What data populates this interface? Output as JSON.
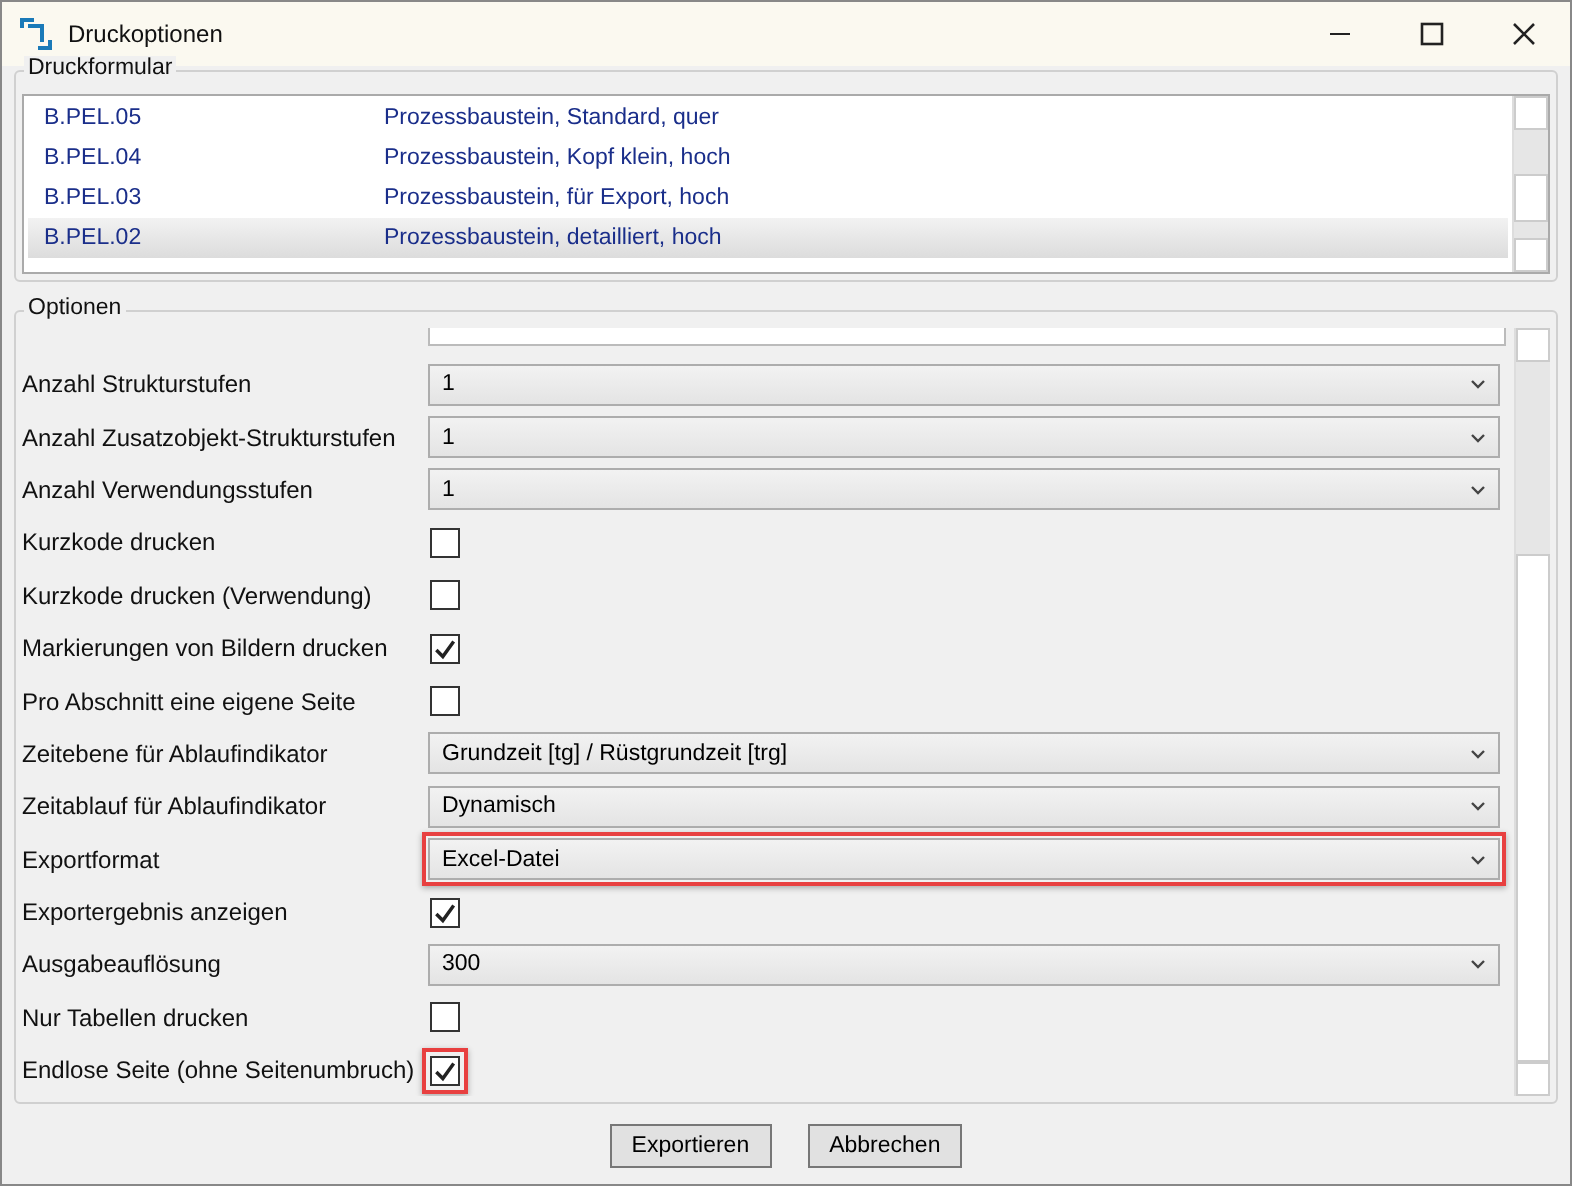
{
  "window": {
    "title": "Druckoptionen"
  },
  "print_form": {
    "title": "Druckformular",
    "rows": [
      {
        "code": "B.PEL.05",
        "description": "Prozessbaustein, Standard, quer",
        "selected": false
      },
      {
        "code": "B.PEL.04",
        "description": "Prozessbaustein, Kopf klein, hoch",
        "selected": false
      },
      {
        "code": "B.PEL.03",
        "description": "Prozessbaustein, für Export, hoch",
        "selected": false
      },
      {
        "code": "B.PEL.02",
        "description": "Prozessbaustein, detailliert, hoch",
        "selected": true
      }
    ]
  },
  "options": {
    "title": "Optionen",
    "items": [
      {
        "kind": "dropdown",
        "label": "Anzahl Strukturstufen",
        "value": "1",
        "highlighted": false
      },
      {
        "kind": "dropdown",
        "label": "Anzahl Zusatzobjekt-Strukturstufen",
        "value": "1",
        "highlighted": false
      },
      {
        "kind": "dropdown",
        "label": "Anzahl Verwendungsstufen",
        "value": "1",
        "highlighted": false
      },
      {
        "kind": "checkbox",
        "label": "Kurzkode drucken",
        "checked": false,
        "highlighted": false
      },
      {
        "kind": "checkbox",
        "label": "Kurzkode drucken (Verwendung)",
        "checked": false,
        "highlighted": false
      },
      {
        "kind": "checkbox",
        "label": "Markierungen von Bildern drucken",
        "checked": true,
        "highlighted": false
      },
      {
        "kind": "checkbox",
        "label": "Pro Abschnitt eine eigene Seite",
        "checked": false,
        "highlighted": false
      },
      {
        "kind": "dropdown",
        "label": "Zeitebene für Ablaufindikator",
        "value": "Grundzeit [tg] / Rüstgrundzeit [trg]",
        "highlighted": false
      },
      {
        "kind": "dropdown",
        "label": "Zeitablauf für Ablaufindikator",
        "value": "Dynamisch",
        "highlighted": false
      },
      {
        "kind": "dropdown",
        "label": "Exportformat",
        "value": "Excel-Datei",
        "highlighted": true
      },
      {
        "kind": "checkbox",
        "label": "Exportergebnis anzeigen",
        "checked": true,
        "highlighted": false
      },
      {
        "kind": "dropdown",
        "label": "Ausgabeauflösung",
        "value": "300",
        "highlighted": false
      },
      {
        "kind": "checkbox",
        "label": "Nur Tabellen drucken",
        "checked": false,
        "highlighted": false
      },
      {
        "kind": "checkbox",
        "label": "Endlose Seite (ohne Seitenumbruch)",
        "checked": true,
        "highlighted": true
      }
    ]
  },
  "buttons": [
    "Exportieren",
    "Abbrechen"
  ]
}
